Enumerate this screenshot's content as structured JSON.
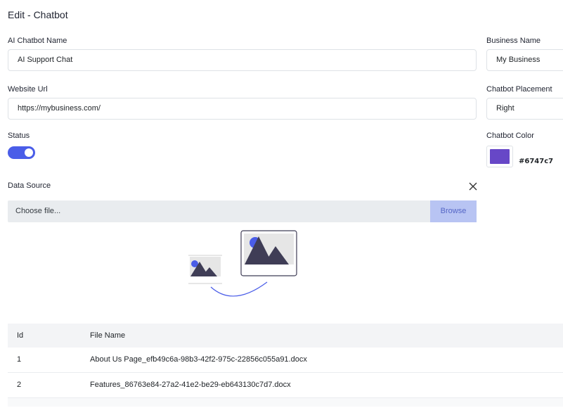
{
  "page": {
    "title": "Edit - Chatbot"
  },
  "form": {
    "chatbot_name": {
      "label": "AI Chatbot Name",
      "value": "AI Support Chat"
    },
    "business_name": {
      "label": "Business Name",
      "value": "My Business"
    },
    "website_url": {
      "label": "Website Url",
      "value": "https://mybusiness.com/"
    },
    "placement": {
      "label": "Chatbot Placement",
      "value": "Right"
    },
    "status": {
      "label": "Status",
      "enabled": true
    },
    "color": {
      "label": "Chatbot Color",
      "value": "#6747c7"
    }
  },
  "data_source": {
    "label": "Data Source",
    "close_icon": "close-icon",
    "file_placeholder": "Choose file...",
    "browse_label": "Browse",
    "illustration_icon": "image-upload-illustration"
  },
  "table": {
    "headers": {
      "id": "Id",
      "file_name": "File Name"
    },
    "rows": [
      {
        "id": "1",
        "file_name": "About Us Page_efb49c6a-98b3-42f2-975c-22856c055a91.docx"
      },
      {
        "id": "2",
        "file_name": "Features_86763e84-27a2-41e2-be29-eb643130c7d7.docx"
      }
    ]
  },
  "colors": {
    "accent": "#4a5de8",
    "swatch": "#6747c7"
  }
}
